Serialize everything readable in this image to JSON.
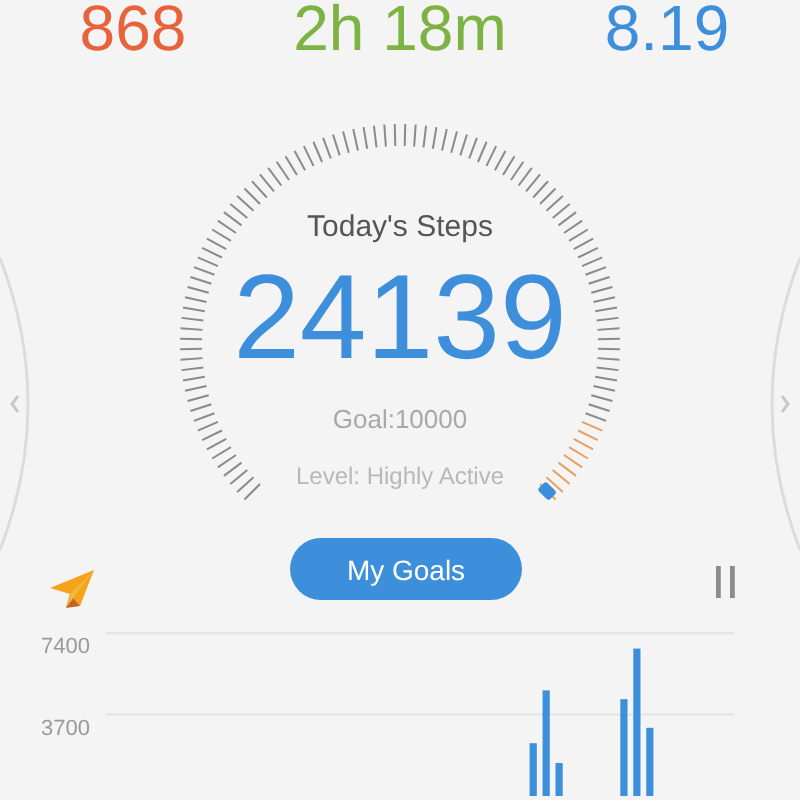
{
  "stats": [
    {
      "value": "868",
      "color": "#e8623a"
    },
    {
      "value": "2h 18m",
      "color": "#7cb342"
    },
    {
      "value": "8.19",
      "color": "#3d8fdb"
    }
  ],
  "gauge": {
    "title": "Today's Steps",
    "steps": "24139",
    "goal": "Goal:10000",
    "activity": "Level: Highly Active"
  },
  "goals_button": "My Goals",
  "chart": {
    "chart_data": {
      "type": "bar",
      "yticks": [
        3700,
        7400
      ],
      "ylim": [
        0,
        7400
      ],
      "values": [
        null,
        null,
        null,
        null,
        null,
        null,
        null,
        null,
        null,
        null,
        null,
        null,
        null,
        null,
        null,
        null,
        null,
        null,
        null,
        null,
        null,
        null,
        null,
        null,
        null,
        null,
        null,
        null,
        null,
        null,
        null,
        null,
        2400,
        4800,
        1500,
        null,
        null,
        null,
        null,
        4400,
        6700,
        3100,
        null,
        null,
        null,
        null,
        null,
        null
      ]
    }
  }
}
